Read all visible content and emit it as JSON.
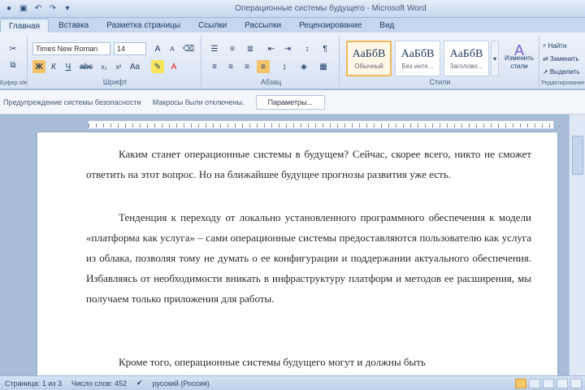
{
  "window": {
    "title": "Операционные системы будущего - Microsoft Word"
  },
  "tabs": [
    {
      "label": "Главная",
      "active": true
    },
    {
      "label": "Вставка",
      "active": false
    },
    {
      "label": "Разметка страницы",
      "active": false
    },
    {
      "label": "Ссылки",
      "active": false
    },
    {
      "label": "Рассылки",
      "active": false
    },
    {
      "label": "Рецензирование",
      "active": false
    },
    {
      "label": "Вид",
      "active": false
    }
  ],
  "ribbon": {
    "font_name": "Times New Roman",
    "font_size": "14",
    "groups": {
      "clipboard": "Буфер обмена",
      "font": "Шрифт",
      "paragraph": "Абзац",
      "styles": "Стили",
      "editing": "Редактирование"
    },
    "styles": [
      {
        "sample": "АаБбВ",
        "name": "Обычный"
      },
      {
        "sample": "АаБбВ",
        "name": "Без инте..."
      },
      {
        "sample": "АаБбВ",
        "name": "Заголово..."
      }
    ],
    "change_styles": "Изменить стили",
    "editing_items": [
      "Найти",
      "Заменить",
      "Выделить"
    ]
  },
  "message_bar": {
    "text": "Предупреждение системы безопасности",
    "detail": "Макросы были отключены.",
    "button": "Параметры..."
  },
  "document": {
    "paragraphs": [
      "Каким станет операционные системы в будущем? Сейчас, скорее всего, никто не сможет ответить на этот вопрос. Но на ближайшее будущее прогнозы развития уже есть.",
      "Тенденция к переходу от локально установленного программного обеспечения к модели «платформа как услуга» – сами операционные системы предоставляются пользователю как услуга из облака, позволяя тому не думать о ее конфигурации и поддержании актуального обеспечения. Избавляясь от необходимости вникать в инфраструктуру платформ и методов ее расширения, мы получаем только приложения для работы.",
      "Кроме того, операционные системы будущего могут и должны быть"
    ]
  },
  "status_bar": {
    "page": "Страница: 1 из 3",
    "words": "Число слов: 452",
    "language": "русский (Россия)"
  },
  "colors": {
    "accent": "#f0b85a",
    "ribbon": "#d6e2f3"
  }
}
